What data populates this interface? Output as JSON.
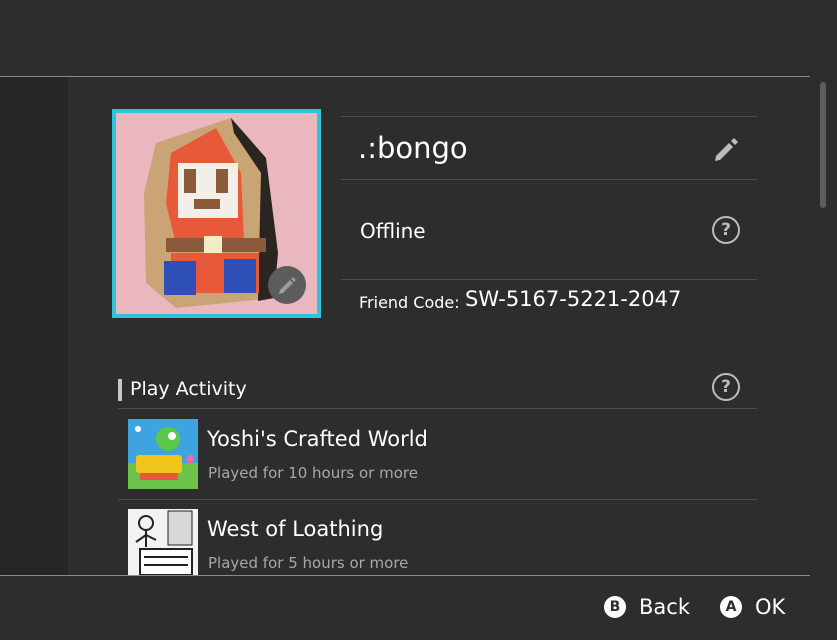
{
  "profile": {
    "username": ".:bongo",
    "status": "Offline",
    "friend_code_label": "Friend Code:",
    "friend_code": "SW-5167-5221-2047"
  },
  "play_activity": {
    "title": "Play Activity",
    "games": [
      {
        "title": "Yoshi's Crafted World",
        "played": "Played for 10 hours or more",
        "icon": "yoshis-crafted-world-icon"
      },
      {
        "title": "West of Loathing",
        "played": "Played for 5 hours or more",
        "icon": "west-of-loathing-icon"
      }
    ]
  },
  "footer": {
    "back_key": "B",
    "back_label": "Back",
    "ok_key": "A",
    "ok_label": "OK"
  },
  "icons": {
    "help": "?",
    "edit": "pencil-icon"
  },
  "colors": {
    "background": "#2d2d2d",
    "avatar_border": "#2fc4dc",
    "secondary_text": "#a8a8a8"
  }
}
